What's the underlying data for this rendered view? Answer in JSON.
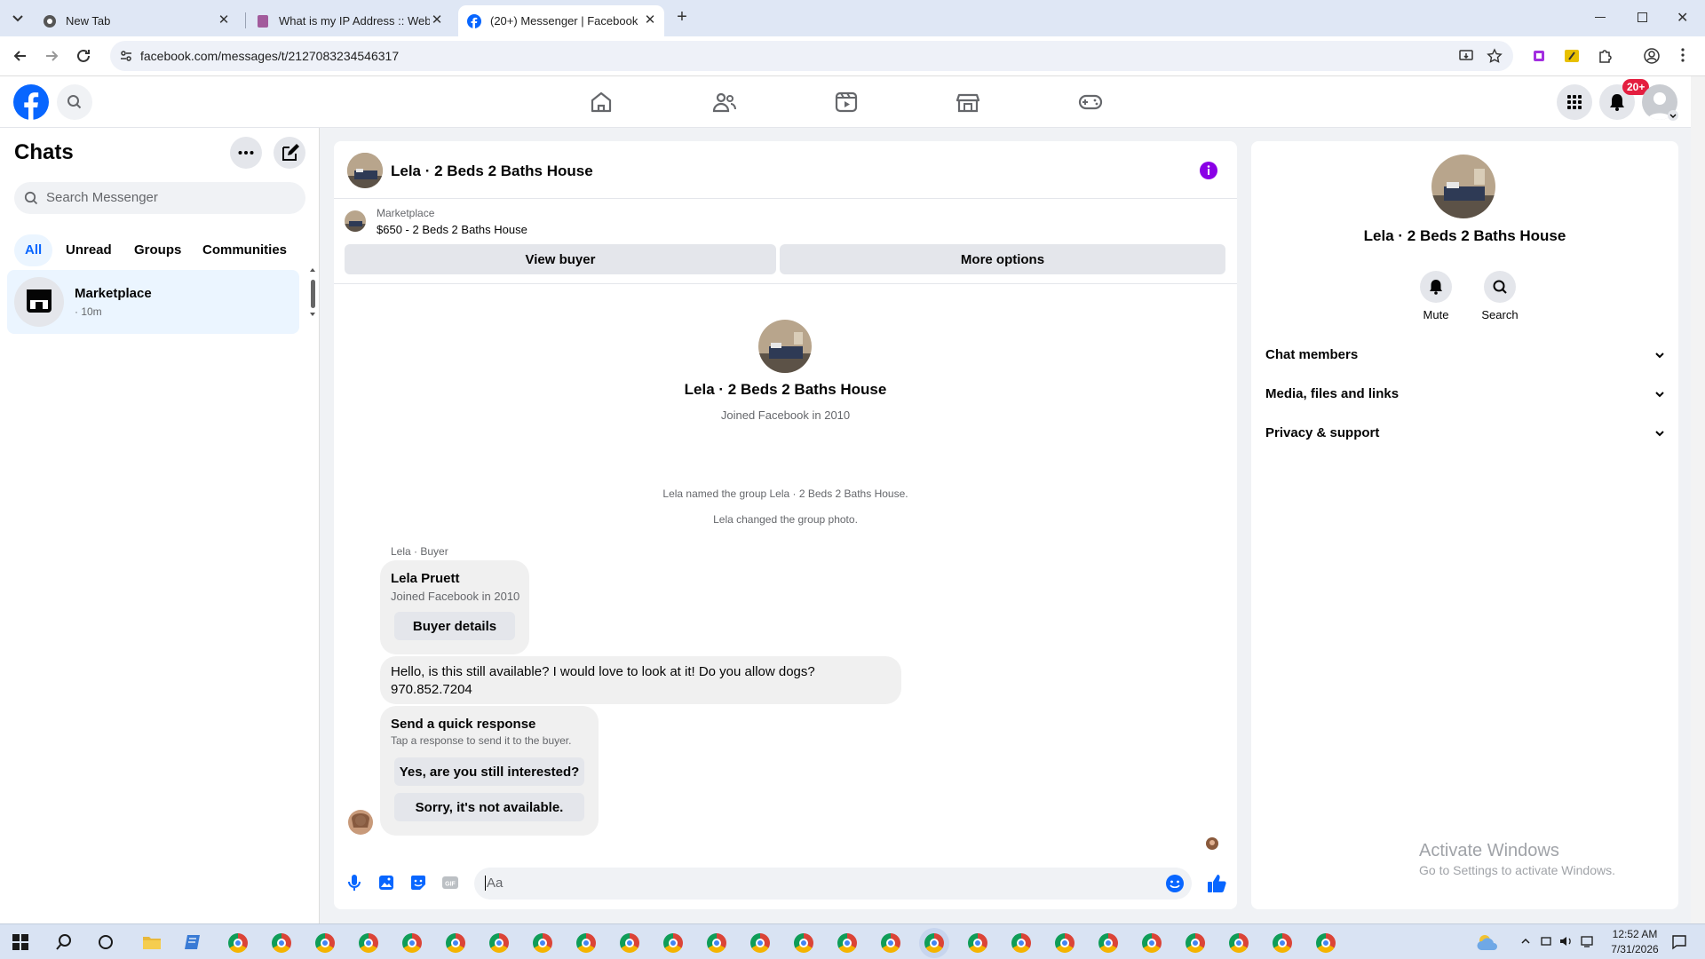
{
  "browser": {
    "tabs": [
      {
        "title": "New Tab"
      },
      {
        "title": "What is my IP Address :: WebBr"
      },
      {
        "title": "(20+) Messenger | Facebook"
      }
    ],
    "url": "facebook.com/messages/t/2127083234546317"
  },
  "fbnav": {
    "notification_badge": "20+"
  },
  "chats": {
    "title": "Chats",
    "search_placeholder": "Search Messenger",
    "filters": [
      "All",
      "Unread",
      "Groups",
      "Communities"
    ],
    "items": [
      {
        "name": "Marketplace",
        "time": "· 10m"
      }
    ]
  },
  "conversation": {
    "header_title": "Lela · 2 Beds 2 Baths House",
    "listing": {
      "source": "Marketplace",
      "price_title": "$650 - 2 Beds 2 Baths House"
    },
    "view_buyer": "View buyer",
    "more_options": "More options",
    "profile_name": "Lela · 2 Beds 2 Baths House",
    "joined": "Joined Facebook in 2010",
    "system_messages": [
      "Lela named the group Lela · 2 Beds 2 Baths House.",
      "Lela changed the group photo."
    ],
    "sender_label": "Lela · Buyer",
    "buyer_card": {
      "name": "Lela Pruett",
      "joined": "Joined Facebook in 2010",
      "button": "Buyer details"
    },
    "message_line1": "Hello, is this still available? I would love to look at it! Do you allow dogs?",
    "message_line2": "970.852.7204",
    "quick": {
      "title": "Send a quick response",
      "subtitle": "Tap a response to send it to the buyer.",
      "options": [
        "Yes, are you still interested?",
        "Sorry, it's not available."
      ]
    },
    "composer_placeholder": "Aa"
  },
  "info_panel": {
    "name": "Lela · 2 Beds 2 Baths House",
    "mute": "Mute",
    "search": "Search",
    "sections": [
      "Chat members",
      "Media, files and links",
      "Privacy & support"
    ]
  },
  "watermark": {
    "title": "Activate Windows",
    "subtitle": "Go to Settings to activate Windows."
  },
  "taskbar": {
    "time": "12:52 AM",
    "date": "7/31/2026"
  },
  "colors": {
    "accent": "#0866ff",
    "info_icon": "#8a00e6",
    "badge": "#e41e3f"
  }
}
